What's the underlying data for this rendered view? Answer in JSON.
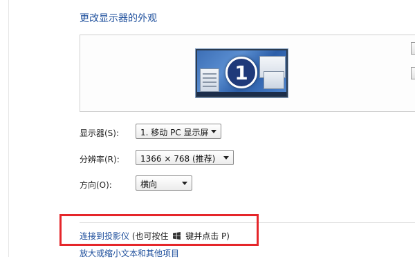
{
  "page": {
    "title": "更改显示器的外观"
  },
  "preview": {
    "monitor_number": "1"
  },
  "settings": {
    "display": {
      "label": "显示器(S):",
      "value": "1. 移动 PC 显示屏"
    },
    "resolution": {
      "label": "分辨率(R):",
      "value": "1366 × 768 (推荐)"
    },
    "orientation": {
      "label": "方向(O):",
      "value": "横向"
    }
  },
  "links": {
    "projector_link": "连接到投影仪",
    "projector_hint_before": "(也可按住",
    "projector_hint_after": "键并点击 P)",
    "magnify": "放大或缩小文本和其他项目"
  },
  "colors": {
    "link": "#1e4f9c",
    "highlight_frame": "#e5262a"
  }
}
